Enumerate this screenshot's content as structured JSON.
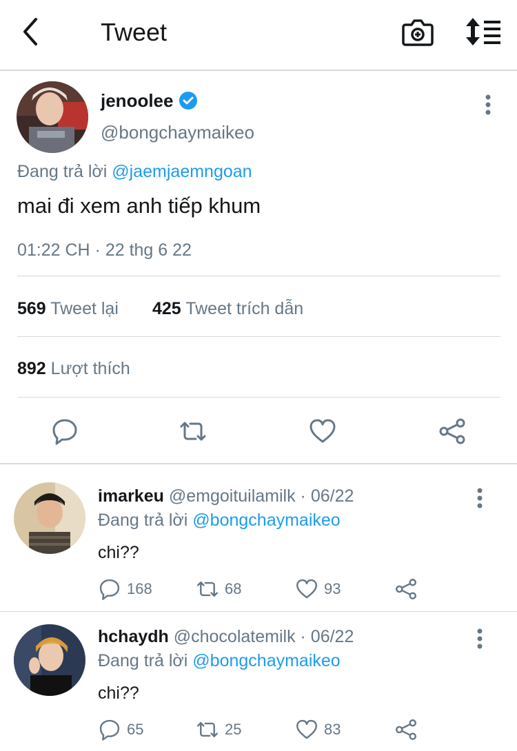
{
  "header": {
    "title": "Tweet"
  },
  "main_tweet": {
    "username": "jenoolee",
    "handle": "@bongchaymaikeo",
    "reply_prefix": "Đang trả lời",
    "reply_mention": "@jaemjaemngoan",
    "text": "mai đi xem anh tiếp khum",
    "timestamp": "01:22 CH · 22 thg 6 22",
    "retweets": {
      "count": "569",
      "label": "Tweet lại"
    },
    "quotes": {
      "count": "425",
      "label": "Tweet trích dẫn"
    },
    "likes": {
      "count": "892",
      "label": "Lượt thích"
    }
  },
  "replies": [
    {
      "username": "imarkeu",
      "handle": "@emgoituilamilk · 06/22",
      "reply_prefix": "Đang trả lời",
      "reply_mention": "@bongchaymaikeo",
      "text": "chi??",
      "comments": "168",
      "retweets": "68",
      "likes": "93"
    },
    {
      "username": "hchaydh",
      "handle": "@chocolatemilk · 06/22",
      "reply_prefix": "Đang trả lời",
      "reply_mention": "@bongchaymaikeo",
      "text": "chi??",
      "comments": "65",
      "retweets": "25",
      "likes": "83"
    }
  ],
  "colors": {
    "accent": "#1d9bf0",
    "secondary_text": "#657786",
    "primary_text": "#14171a",
    "divider": "#d9d9d9"
  }
}
